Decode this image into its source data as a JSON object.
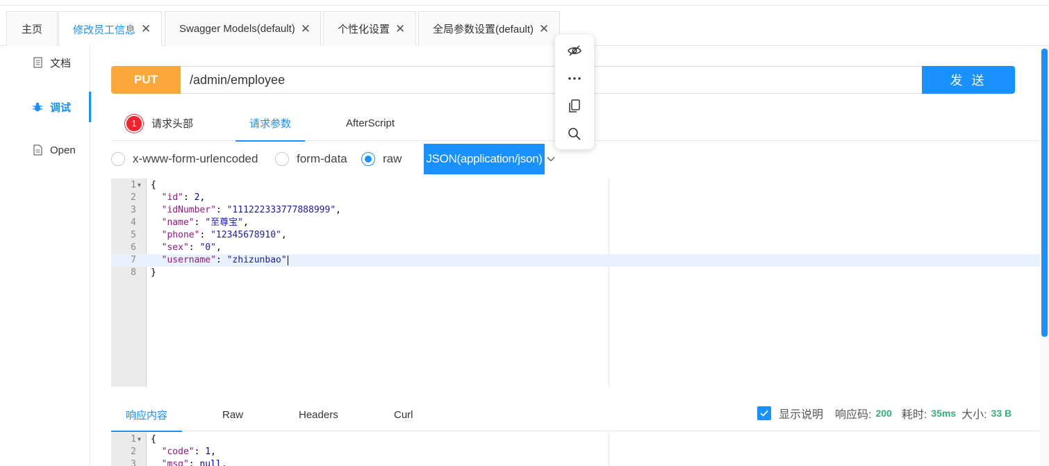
{
  "tabs": [
    {
      "label": "主页",
      "closable": false,
      "active": false
    },
    {
      "label": "修改员工信息",
      "closable": true,
      "active": true
    },
    {
      "label": "Swagger Models(default)",
      "closable": true,
      "active": false
    },
    {
      "label": "个性化设置",
      "closable": true,
      "active": false
    },
    {
      "label": "全局参数设置(default)",
      "closable": true,
      "active": false
    }
  ],
  "close_glyph": "✕",
  "sidebar": {
    "items": [
      {
        "label": "文档",
        "icon": "document-icon"
      },
      {
        "label": "调试",
        "icon": "bug-icon",
        "active": true
      },
      {
        "label": "Open",
        "icon": "file-icon"
      }
    ]
  },
  "request": {
    "method": "PUT",
    "url": "/admin/employee",
    "send_label": "发 送"
  },
  "param_tabs": {
    "headers_label": "请求头部",
    "headers_count": "1",
    "params_label": "请求参数",
    "afterscript_label": "AfterScript"
  },
  "body_types": {
    "urlencoded": "x-www-form-urlencoded",
    "formdata": "form-data",
    "raw": "raw",
    "content_type": "JSON(application/json)"
  },
  "request_body": {
    "lines": [
      {
        "n": "1",
        "text": "{"
      },
      {
        "n": "2",
        "key": "\"id\"",
        "sep": ": ",
        "val": "2",
        "tail": ","
      },
      {
        "n": "3",
        "key": "\"idNumber\"",
        "sep": ": ",
        "val": "\"111222333777888999\"",
        "tail": ","
      },
      {
        "n": "4",
        "key": "\"name\"",
        "sep": ": ",
        "val": "\"至尊宝\"",
        "tail": ","
      },
      {
        "n": "5",
        "key": "\"phone\"",
        "sep": ": ",
        "val": "\"12345678910\"",
        "tail": ","
      },
      {
        "n": "6",
        "key": "\"sex\"",
        "sep": ": ",
        "val": "\"0\"",
        "tail": ","
      },
      {
        "n": "7",
        "key": "\"username\"",
        "sep": ": ",
        "val": "\"zhizunbao\"",
        "tail": ""
      },
      {
        "n": "8",
        "text": "}"
      }
    ]
  },
  "response_tabs": {
    "content": "响应内容",
    "raw": "Raw",
    "headers": "Headers",
    "curl": "Curl"
  },
  "response_stats": {
    "show_desc_label": "显示说明",
    "code_label": "响应码:",
    "code_value": "200",
    "time_label": "耗时:",
    "time_value": "35ms",
    "size_label": "大小:",
    "size_value": "33 B"
  },
  "response_body": {
    "lines": [
      {
        "n": "1",
        "text": "{"
      },
      {
        "n": "2",
        "key": "\"code\"",
        "sep": ": ",
        "val": "1",
        "tail": ","
      },
      {
        "n": "3",
        "key": "\"msg\"",
        "sep": ": ",
        "val": "null",
        "tail": ","
      }
    ]
  },
  "floating_toolbar": [
    "eye-off-icon",
    "more-icon",
    "copy-icon",
    "search-icon"
  ],
  "colors": {
    "accent": "#1890ff",
    "method_put": "#fba73a",
    "badge": "#f5222d",
    "stat_green": "#2db37b"
  }
}
